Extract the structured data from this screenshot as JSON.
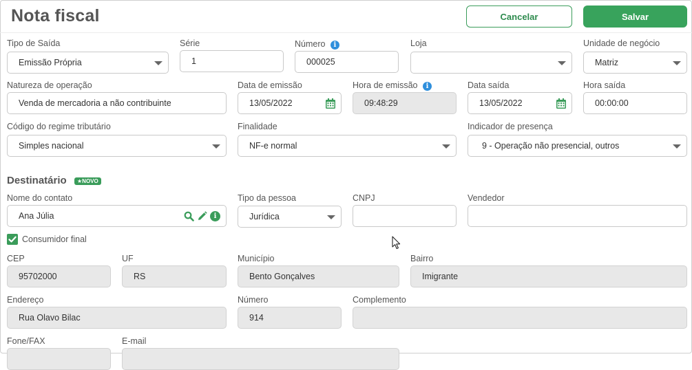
{
  "header": {
    "title": "Nota fiscal",
    "cancel_label": "Cancelar",
    "save_label": "Salvar"
  },
  "form": {
    "tipo_saida": {
      "label": "Tipo de Saída",
      "value": "Emissão Própria"
    },
    "serie": {
      "label": "Série",
      "value": "1"
    },
    "numero": {
      "label": "Número",
      "value": "000025"
    },
    "loja": {
      "label": "Loja",
      "value": ""
    },
    "unidade_negocio": {
      "label": "Unidade de negócio",
      "value": "Matriz"
    },
    "natureza_operacao": {
      "label": "Natureza de operação",
      "value": "Venda de mercadoria a não contribuinte"
    },
    "data_emissao": {
      "label": "Data de emissão",
      "value": "13/05/2022"
    },
    "hora_emissao": {
      "label": "Hora de emissão",
      "value": "09:48:29"
    },
    "data_saida": {
      "label": "Data saída",
      "value": "13/05/2022"
    },
    "hora_saida": {
      "label": "Hora saída",
      "value": "00:00:00"
    },
    "regime_tributario": {
      "label": "Código do regime tributário",
      "value": "Simples nacional"
    },
    "finalidade": {
      "label": "Finalidade",
      "value": "NF-e normal"
    },
    "indicador_presenca": {
      "label": "Indicador de presença",
      "value": "9 - Operação não presencial, outros"
    }
  },
  "destinatario": {
    "section_title": "Destinatário",
    "badge": "★NOVO",
    "nome_contato": {
      "label": "Nome do contato",
      "value": "Ana Júlia"
    },
    "tipo_pessoa": {
      "label": "Tipo da pessoa",
      "value": "Jurídica"
    },
    "cnpj": {
      "label": "CNPJ",
      "value": ""
    },
    "vendedor": {
      "label": "Vendedor",
      "value": ""
    },
    "consumidor_final": {
      "label": "Consumidor final",
      "checked": true
    },
    "cep": {
      "label": "CEP",
      "value": "95702000"
    },
    "uf": {
      "label": "UF",
      "value": "RS"
    },
    "municipio": {
      "label": "Município",
      "value": "Bento Gonçalves"
    },
    "bairro": {
      "label": "Bairro",
      "value": "Imigrante"
    },
    "endereco": {
      "label": "Endereço",
      "value": "Rua Olavo Bilac"
    },
    "numero": {
      "label": "Número",
      "value": "914"
    },
    "complemento": {
      "label": "Complemento",
      "value": ""
    },
    "fone": {
      "label": "Fone/FAX",
      "value": ""
    },
    "email": {
      "label": "E-mail",
      "value": ""
    }
  },
  "colors": {
    "accent_green": "#38a35c",
    "info_blue": "#2f8fdc",
    "readonly_bg": "#e8e8e8"
  },
  "icons": [
    "info-icon",
    "calendar-icon",
    "chevron-down-icon",
    "search-icon",
    "pencil-icon",
    "check-icon",
    "mouse-cursor-icon"
  ]
}
